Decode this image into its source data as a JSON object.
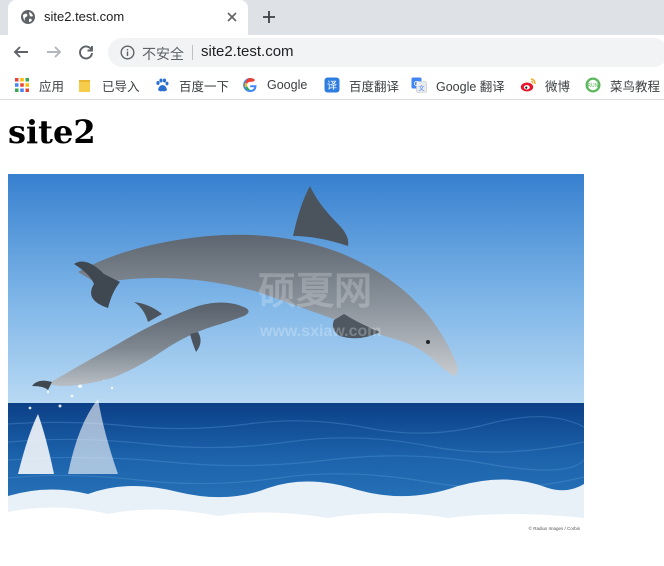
{
  "browser": {
    "tab": {
      "title": "site2.test.com",
      "favicon": "globe-icon"
    },
    "toolbar": {
      "back_icon": "arrow-left-icon",
      "forward_icon": "arrow-right-icon",
      "reload_icon": "reload-icon",
      "security_icon": "info-circle-icon",
      "security_label": "不安全",
      "url": "site2.test.com"
    },
    "bookmarks": [
      {
        "label": "应用",
        "icon": "apps-grid-icon"
      },
      {
        "label": "已导入",
        "icon": "folder-icon"
      },
      {
        "label": "百度一下",
        "icon": "baidu-paw-icon"
      },
      {
        "label": "Google",
        "icon": "google-g-icon"
      },
      {
        "label": "百度翻译",
        "icon": "baidu-translate-icon"
      },
      {
        "label": "Google 翻译",
        "icon": "google-translate-icon"
      },
      {
        "label": "微博",
        "icon": "weibo-icon"
      },
      {
        "label": "菜鸟教程",
        "icon": "runoob-icon"
      }
    ]
  },
  "page": {
    "heading": "site2",
    "image": {
      "subject": "two dolphins leaping over ocean",
      "credit": "© Radius Images / Corbis"
    }
  },
  "colors": {
    "tabstrip": "#dee1e6",
    "omnibox": "#f1f3f4",
    "sky_top": "#3a86d1",
    "sea": "#1f5f9f"
  }
}
